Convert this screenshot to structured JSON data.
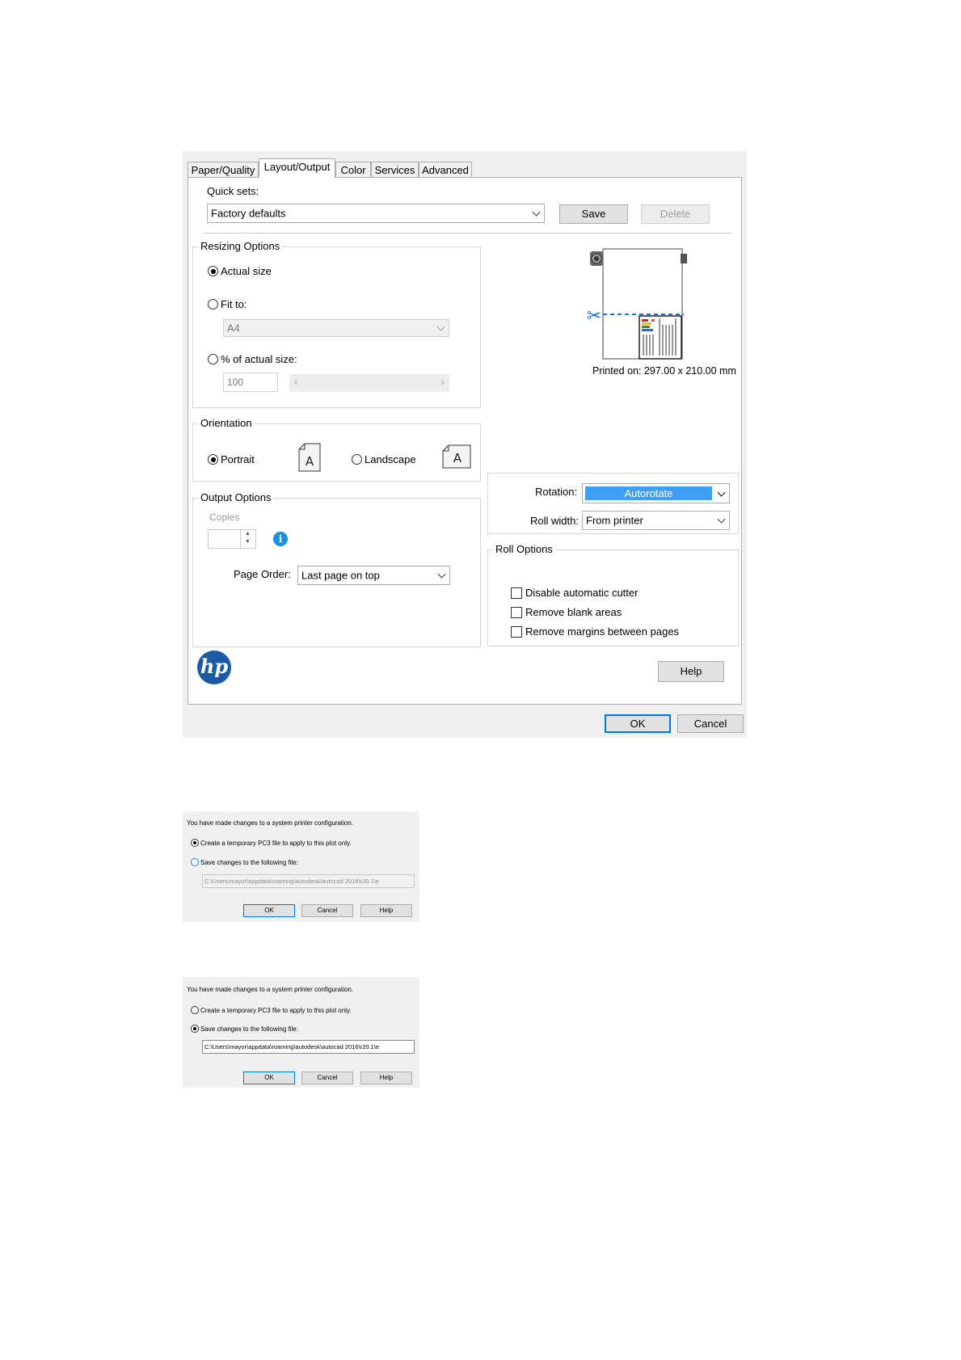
{
  "tabs": [
    "Paper/Quality",
    "Layout/Output",
    "Color",
    "Services",
    "Advanced"
  ],
  "active_tab": "Layout/Output",
  "quick_sets": {
    "label": "Quick sets:",
    "value": "Factory defaults",
    "save": "Save",
    "delete": "Delete"
  },
  "resizing": {
    "title": "Resizing Options",
    "actual_size": "Actual size",
    "fit_to": "Fit to:",
    "fit_value": "A4",
    "percent": "% of actual size:",
    "percent_value": "100",
    "selected": "Actual size"
  },
  "preview": {
    "printed_on": "Printed on: 297.00 x 210.00 mm"
  },
  "orientation": {
    "title": "Orientation",
    "portrait": "Portrait",
    "landscape": "Landscape",
    "icon_letter": "A",
    "selected": "Portrait"
  },
  "rotation": {
    "label": "Rotation:",
    "value": "Autorotate",
    "highlight_color": "#3d9ff5"
  },
  "roll_width": {
    "label": "Roll width:",
    "value": "From printer"
  },
  "output": {
    "title": "Output Options",
    "copies_label": "Copies",
    "page_order_label": "Page Order:",
    "page_order_value": "Last page on top"
  },
  "roll_options": {
    "title": "Roll Options",
    "items": [
      "Disable automatic cutter",
      "Remove blank areas",
      "Remove margins between pages"
    ]
  },
  "logo": {
    "text": "hp",
    "color": "#1b5aa6"
  },
  "buttons": {
    "help": "Help",
    "ok": "OK",
    "cancel": "Cancel"
  },
  "config_dialogs": [
    {
      "message": "You have made changes to a system printer configuration.",
      "option_temp": "Create a temporary PC3 file to apply to this plot only.",
      "option_save": "Save changes to the following file:",
      "path": "C:\\Users\\mayor\\appdata\\roaming\\autodesk\\autocad 2016\\r20.1\\e",
      "selected": "temp",
      "ok": "OK",
      "cancel": "Cancel",
      "help": "Help"
    },
    {
      "message": "You have made changes to a system printer configuration.",
      "option_temp": "Create a temporary PC3 file to apply to this plot only.",
      "option_save": "Save changes to the following file:",
      "path": "C:\\Users\\mayor\\appdata\\roaming\\autodesk\\autocad 2016\\r20.1\\e",
      "selected": "save",
      "ok": "OK",
      "cancel": "Cancel",
      "help": "Help"
    }
  ]
}
